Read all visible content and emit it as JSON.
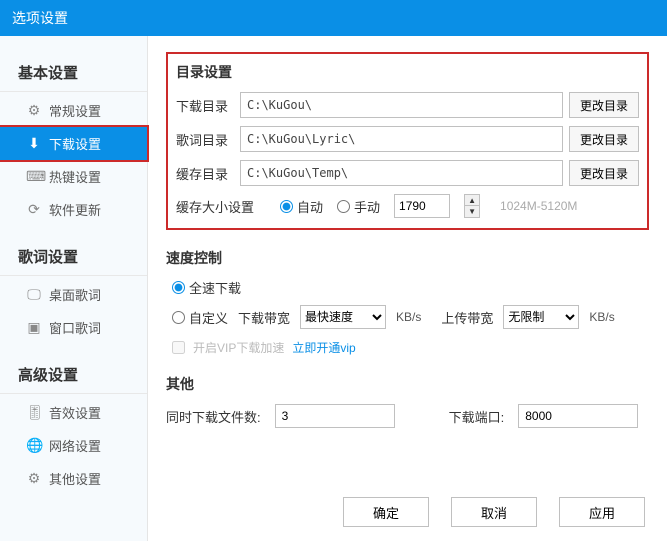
{
  "title": "选项设置",
  "sidebar": {
    "sections": [
      {
        "title": "基本设置",
        "items": [
          {
            "icon": "⚙",
            "label": "常规设置",
            "active": false
          },
          {
            "icon": "⬇",
            "label": "下载设置",
            "active": true
          },
          {
            "icon": "⌨",
            "label": "热键设置",
            "active": false
          },
          {
            "icon": "⟳",
            "label": "软件更新",
            "active": false
          }
        ]
      },
      {
        "title": "歌词设置",
        "items": [
          {
            "icon": "🖵",
            "label": "桌面歌词",
            "active": false
          },
          {
            "icon": "▣",
            "label": "窗口歌词",
            "active": false
          }
        ]
      },
      {
        "title": "高级设置",
        "items": [
          {
            "icon": "🎚",
            "label": "音效设置",
            "active": false
          },
          {
            "icon": "🌐",
            "label": "网络设置",
            "active": false
          },
          {
            "icon": "⚙",
            "label": "其他设置",
            "active": false
          }
        ]
      }
    ]
  },
  "directory": {
    "title": "目录设置",
    "rows": [
      {
        "label": "下载目录",
        "path": "C:\\KuGou\\",
        "btn": "更改目录"
      },
      {
        "label": "歌词目录",
        "path": "C:\\KuGou\\Lyric\\",
        "btn": "更改目录"
      },
      {
        "label": "缓存目录",
        "path": "C:\\KuGou\\Temp\\",
        "btn": "更改目录"
      }
    ],
    "cache": {
      "label": "缓存大小设置",
      "auto": "自动",
      "manual": "手动",
      "value": "1790",
      "range": "1024M-5120M"
    }
  },
  "speed": {
    "title": "速度控制",
    "full": "全速下载",
    "custom": "自定义",
    "downLabel": "下载带宽",
    "downOption": "最快速度",
    "upLabel": "上传带宽",
    "upOption": "无限制",
    "unit": "KB/s",
    "vipChk": "开启VIP下载加速",
    "vipLink": "立即开通vip"
  },
  "other": {
    "title": "其他",
    "filesLabel": "同时下载文件数:",
    "filesValue": "3",
    "portLabel": "下载端口:",
    "portValue": "8000"
  },
  "footer": {
    "ok": "确定",
    "cancel": "取消",
    "apply": "应用"
  }
}
